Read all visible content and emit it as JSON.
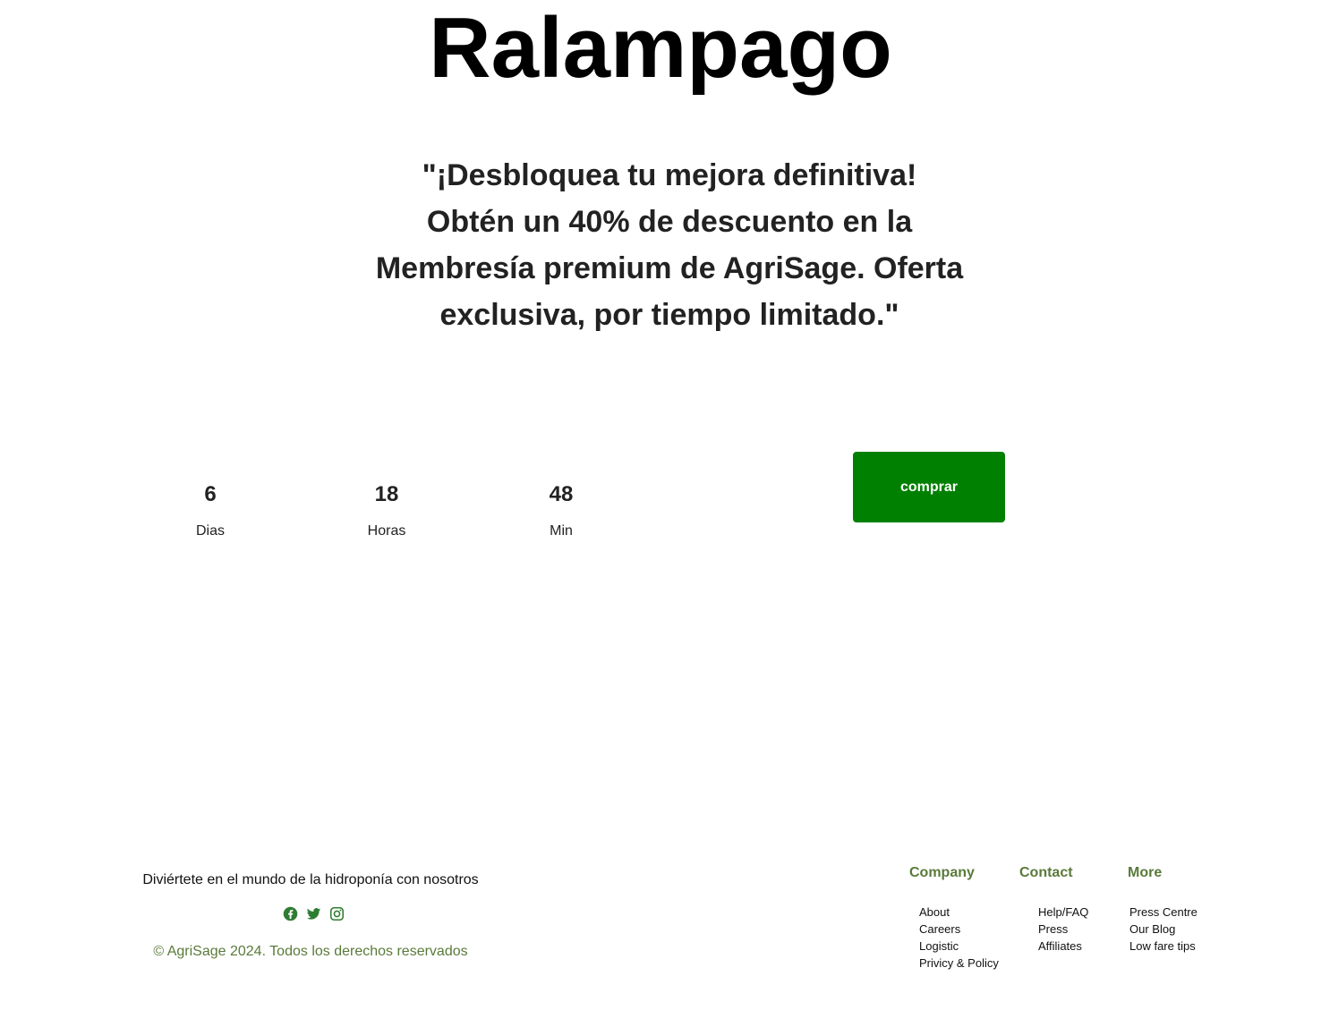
{
  "hero": {
    "title": "Ralampago",
    "promo": "\"¡Desbloquea tu mejora definitiva! Obtén un 40% de descuento en la Membresía premium de AgriSage. Oferta exclusiva, por tiempo limitado.\""
  },
  "countdown": {
    "days": {
      "value": "6",
      "label": "Dias"
    },
    "hours": {
      "value": "18",
      "label": "Horas"
    },
    "minutes": {
      "value": "48",
      "label": "Min"
    }
  },
  "cta": {
    "label": "comprar",
    "color": "#008000"
  },
  "footer": {
    "tagline": "Diviértete en el mundo de la hidroponía con nosotros",
    "social_icons": [
      "facebook-icon",
      "twitter-icon",
      "instagram-icon"
    ],
    "copyright": "© AgriSage 2024. Todos los derechos reservados",
    "accent_color": "#5a7a3a",
    "columns": [
      {
        "title": "Company",
        "links": [
          "About",
          "Careers",
          "Logistic",
          "Privicy & Policy"
        ]
      },
      {
        "title": "Contact",
        "links": [
          "Help/FAQ",
          "Press",
          "Affiliates"
        ]
      },
      {
        "title": "More",
        "links": [
          "Press Centre",
          "Our Blog",
          "Low fare tips"
        ]
      }
    ]
  }
}
